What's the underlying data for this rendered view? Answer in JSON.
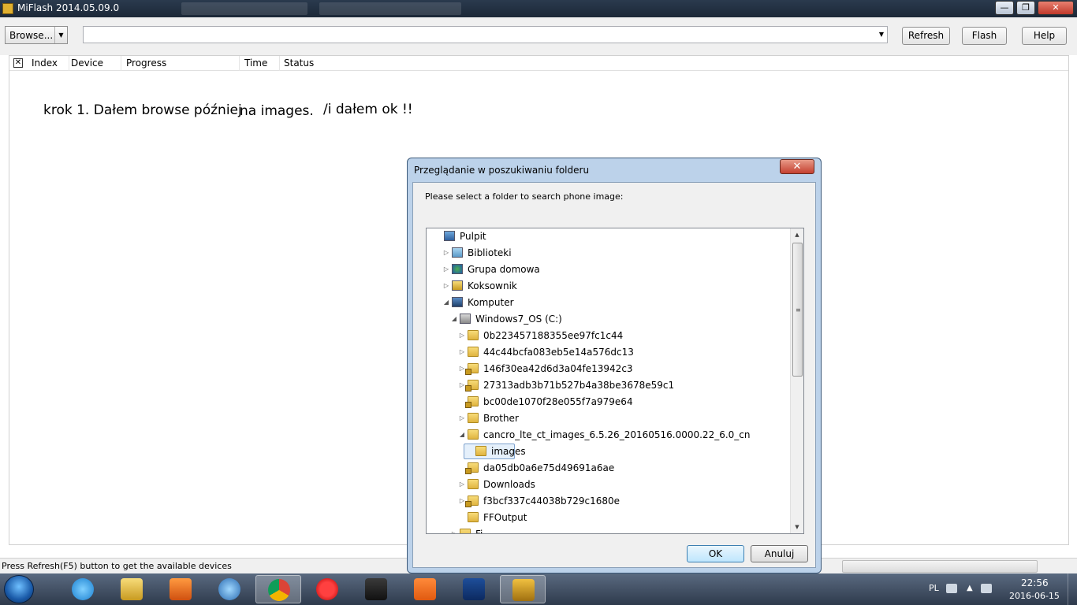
{
  "window": {
    "title": "MiFlash 2014.05.09.0",
    "minimize_label": "—",
    "maximize_label": "❐",
    "close_label": "✕"
  },
  "toolbar": {
    "browse_label": "Browse...",
    "path_value": "",
    "refresh_label": "Refresh",
    "flash_label": "Flash",
    "help_label": "Help"
  },
  "list": {
    "columns": [
      "Index",
      "Device",
      "Progress",
      "Time",
      "Status"
    ]
  },
  "notes": {
    "part1": "krok 1. Dałem browse później",
    "part2": "na images.",
    "part3": "/i dałem ok !!"
  },
  "status": {
    "text": "Press Refresh(F5) button to get the available devices"
  },
  "dialog": {
    "title": "Przeglądanie w poszukiwaniu folderu",
    "close_label": "✕",
    "prompt": "Please select a folder to search phone image:",
    "ok_label": "OK",
    "cancel_label": "Anuluj",
    "tree": [
      {
        "label": "Pulpit",
        "icon": "desktop-icon",
        "expander": ""
      },
      {
        "label": "Biblioteki",
        "icon": "libraries-icon",
        "expander": "collapsed"
      },
      {
        "label": "Grupa domowa",
        "icon": "homegroup-icon",
        "expander": "collapsed"
      },
      {
        "label": "Koksownik",
        "icon": "user-folder-icon",
        "expander": "collapsed"
      },
      {
        "label": "Komputer",
        "icon": "computer-icon",
        "expander": "expanded"
      },
      {
        "label": "Windows7_OS (C:)",
        "icon": "drive-icon",
        "expander": "expanded"
      },
      {
        "label": "0b223457188355ee97fc1c44",
        "icon": "folder-icon",
        "expander": "collapsed"
      },
      {
        "label": "44c44bcfa083eb5e14a576dc13",
        "icon": "folder-icon",
        "expander": "collapsed"
      },
      {
        "label": "146f30ea42d6d3a04fe13942c3",
        "icon": "locked-folder-icon",
        "expander": "collapsed"
      },
      {
        "label": "27313adb3b71b527b4a38be3678e59c1",
        "icon": "locked-folder-icon",
        "expander": "collapsed"
      },
      {
        "label": "bc00de1070f28e055f7a979e64",
        "icon": "locked-folder-icon",
        "expander": ""
      },
      {
        "label": "Brother",
        "icon": "folder-icon",
        "expander": "collapsed"
      },
      {
        "label": "cancro_lte_ct_images_6.5.26_20160516.0000.22_6.0_cn",
        "icon": "folder-icon",
        "expander": "expanded"
      },
      {
        "label": "images",
        "icon": "folder-icon",
        "expander": "",
        "selected": true
      },
      {
        "label": "da05db0a6e75d49691a6ae",
        "icon": "locked-folder-icon",
        "expander": ""
      },
      {
        "label": "Downloads",
        "icon": "folder-icon",
        "expander": "collapsed"
      },
      {
        "label": "f3bcf337c44038b729c1680e",
        "icon": "locked-folder-icon",
        "expander": "collapsed"
      },
      {
        "label": "FFOutput",
        "icon": "folder-icon",
        "expander": ""
      }
    ]
  },
  "taskbar": {
    "apps": [
      "internet-explorer-icon",
      "file-explorer-icon",
      "media-player-icon",
      "network-globe-icon",
      "chrome-icon",
      "opera-icon",
      "task-manager-icon",
      "shopping-basket-icon",
      "b-app-icon",
      "miflash-icon"
    ],
    "language": "PL",
    "time": "22:56",
    "date": "2016-06-15"
  },
  "colors": {
    "titlebar": "#1c2838",
    "dialog_frame": "#bcd2ea",
    "selection": "#e5f0fb",
    "taskbar": "#2e3a4c"
  }
}
